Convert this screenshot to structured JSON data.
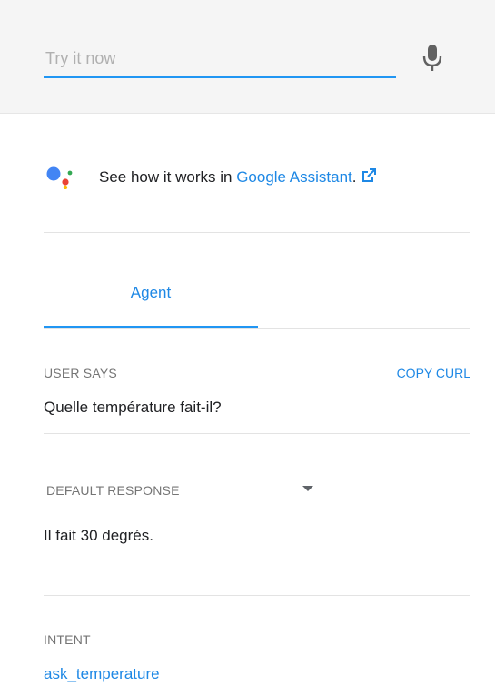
{
  "search": {
    "placeholder": "Try it now",
    "mic_icon": "microphone-icon"
  },
  "assistant": {
    "logo_icon": "google-assistant-icon",
    "prefix_text": "See how it works in ",
    "link_text": "Google Assistant",
    "suffix_text": ".",
    "external_icon": "external-link-icon"
  },
  "tabs": [
    {
      "label": "Agent",
      "active": true
    }
  ],
  "user_says": {
    "label": "USER SAYS",
    "copy_label": "COPY CURL",
    "value": "Quelle température fait-il?"
  },
  "default_response": {
    "label": "DEFAULT RESPONSE",
    "value": "Il fait 30 degrés."
  },
  "intent": {
    "label": "INTENT",
    "value": "ask_temperature"
  },
  "colors": {
    "accent": "#2196f3",
    "link": "#1e88e5",
    "top_bar_bg": "#f5f5f5",
    "label_gray": "#757575"
  }
}
